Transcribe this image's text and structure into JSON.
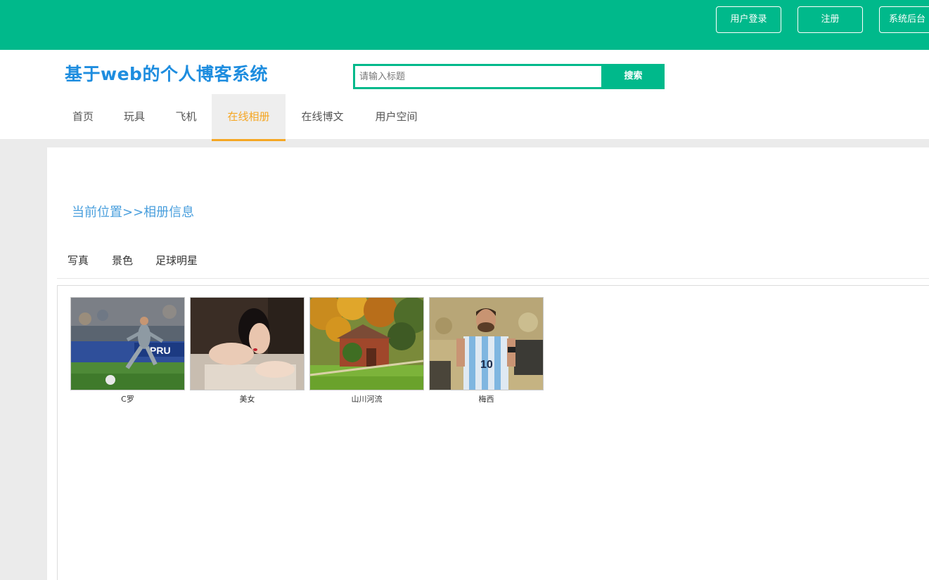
{
  "topbar": {
    "login_label": "用户登录",
    "register_label": "注册",
    "admin_label": "系统后台"
  },
  "header": {
    "site_title": "基于web的个人博客系统",
    "search_placeholder": "请输入标题",
    "search_button": "搜索"
  },
  "nav": {
    "items": [
      {
        "label": "首页"
      },
      {
        "label": "玩具"
      },
      {
        "label": "飞机"
      },
      {
        "label": "在线相册"
      },
      {
        "label": "在线博文"
      },
      {
        "label": "用户空间"
      }
    ],
    "active_index": 3
  },
  "breadcrumb": "当前位置>>相册信息",
  "categories": [
    "写真",
    "景色",
    "足球明星"
  ],
  "gallery": [
    {
      "caption": "C罗",
      "photo": "footballer-kicking-ball-photo"
    },
    {
      "caption": "美女",
      "photo": "woman-portrait-photo"
    },
    {
      "caption": "山川河流",
      "photo": "autumn-barn-landscape-photo"
    },
    {
      "caption": "梅西",
      "photo": "footballer-in-argentina-shirt-photo"
    }
  ],
  "colors": {
    "brand_green": "#00b98b",
    "title_blue": "#1e8ddf",
    "active_orange": "#f5a623",
    "crumb_blue": "#4a9fdd"
  }
}
